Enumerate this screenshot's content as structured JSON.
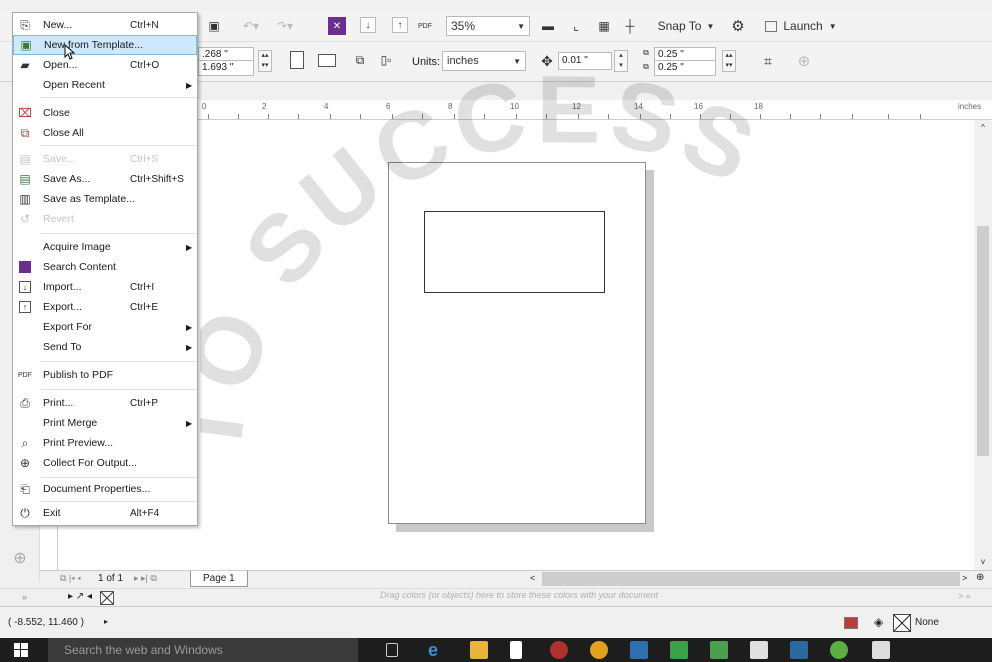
{
  "standard_toolbar": {
    "zoom": "35%",
    "snap_to": "Snap To",
    "launch": "Launch"
  },
  "property_bar": {
    "width_value": ".268 \"",
    "height_value": "1.693 \"",
    "units_label": "Units:",
    "units_value": "inches",
    "nudge_value": "0.01 \"",
    "dup_x": "0.25 \"",
    "dup_y": "0.25 \""
  },
  "ruler": {
    "ticks": [
      "0",
      "2",
      "4",
      "6",
      "8",
      "10",
      "12",
      "14",
      "16",
      "18"
    ],
    "unit": "inches"
  },
  "file_menu": {
    "new": {
      "label": "New...",
      "shortcut": "Ctrl+N"
    },
    "new_from_template": {
      "label": "New from Template..."
    },
    "open": {
      "label": "Open...",
      "shortcut": "Ctrl+O"
    },
    "open_recent": {
      "label": "Open Recent"
    },
    "close": {
      "label": "Close"
    },
    "close_all": {
      "label": "Close All"
    },
    "save": {
      "label": "Save...",
      "shortcut": "Ctrl+S"
    },
    "save_as": {
      "label": "Save As...",
      "shortcut": "Ctrl+Shift+S"
    },
    "save_as_template": {
      "label": "Save as Template..."
    },
    "revert": {
      "label": "Revert"
    },
    "acquire_image": {
      "label": "Acquire Image"
    },
    "search_content": {
      "label": "Search Content"
    },
    "import": {
      "label": "Import...",
      "shortcut": "Ctrl+I"
    },
    "export": {
      "label": "Export...",
      "shortcut": "Ctrl+E"
    },
    "export_for": {
      "label": "Export For"
    },
    "send_to": {
      "label": "Send To"
    },
    "publish_pdf": {
      "label": "Publish to PDF"
    },
    "print": {
      "label": "Print...",
      "shortcut": "Ctrl+P"
    },
    "print_merge": {
      "label": "Print Merge"
    },
    "print_preview": {
      "label": "Print Preview..."
    },
    "collect_output": {
      "label": "Collect For Output..."
    },
    "doc_properties": {
      "label": "Document Properties..."
    },
    "exit": {
      "label": "Exit",
      "shortcut": "Alt+F4"
    }
  },
  "page_nav": {
    "page_count": "1 of 1",
    "page_tab": "Page 1"
  },
  "palette_hint": "Drag colors (or objects) here to store these colors with your document",
  "status": {
    "coords": "( -8.552, 11.460 )",
    "fill_label": "None"
  },
  "taskbar": {
    "search_placeholder": "Search the web and Windows"
  },
  "watermark_text": "TO SUCCESS",
  "colors": {
    "menu_highlight": "#cde8ff",
    "taskbar": "#1d1d1d"
  }
}
